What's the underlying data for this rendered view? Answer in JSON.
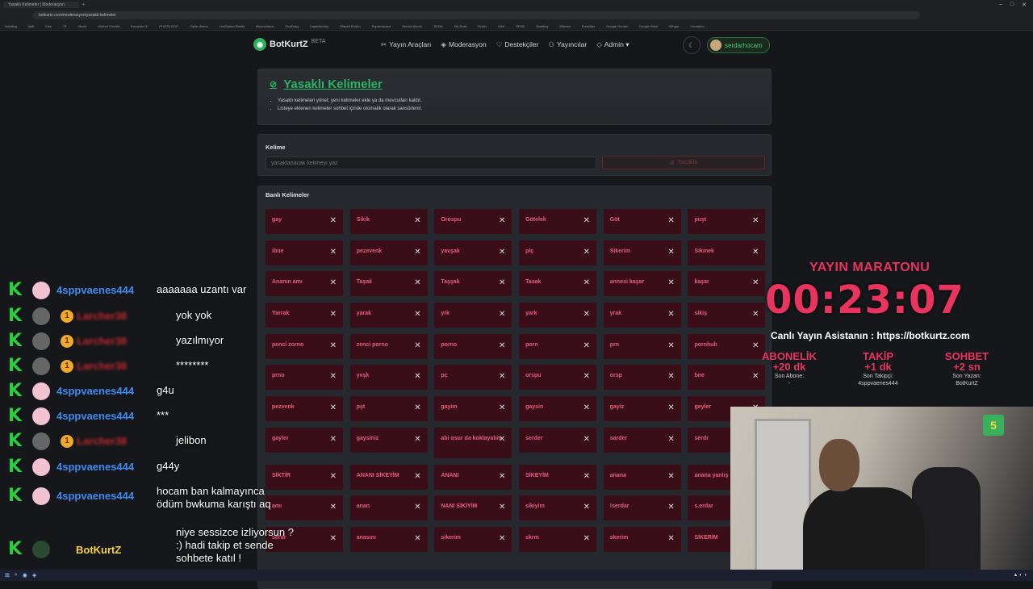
{
  "browser": {
    "tab_title": "Yasaklı Kelimeler | Moderasyon",
    "url": "botkurtz.com/moderasyon/yasakli-kelimeler",
    "bookmarks": [
      "Instaling",
      "İyafi",
      "Kick",
      "YT",
      "Music",
      "Winbef Checkti",
      "Envanter IY",
      "PHOTN EDIT",
      "Cyber Arena",
      "LiveSpeed Rakibi",
      "Meyvedance",
      "OneDrag",
      "Capacitorkey",
      "Olaneti Rodeo",
      "Squarespace",
      "Servlar Album",
      "TikTok",
      "Kik-Chat",
      "Flutter",
      "Kirbi",
      "SEND",
      "Madalay",
      "Mümaa",
      "Freeclips",
      "Google Gemini",
      "Google Slaat",
      "Klingor",
      "Contadoo"
    ]
  },
  "nav": {
    "brand": "BotKurtZ",
    "beta": "BETA",
    "items": [
      {
        "icon": "✂",
        "label": "Yayın Araçları"
      },
      {
        "icon": "◈",
        "label": "Moderasyon"
      },
      {
        "icon": "♡",
        "label": "Destekçiler"
      },
      {
        "icon": "⚇",
        "label": "Yayıncılar"
      },
      {
        "icon": "◇",
        "label": "Admin ▾"
      }
    ],
    "username": "serdarhocam"
  },
  "page": {
    "title": "Yasaklı Kelimeler",
    "desc1": "Yasaklı kelimeleri yönet; yeni kelimeler ekle ya da mevcutları kaldır.",
    "desc2": "Listeye eklenen kelimeler sohbet içinde otomatik olarak sansürlenir."
  },
  "form": {
    "label": "Kelime",
    "placeholder": "yasaklanacak kelimeyi yaz",
    "button": "Yasakla"
  },
  "list": {
    "title": "Banlı Kelimeler",
    "words": [
      "gay",
      "Sikik",
      "Orospu",
      "Götelek",
      "Göt",
      "puşt",
      "ibne",
      "pezevenk",
      "yavşak",
      "piç",
      "Sikerim",
      "Sikmek",
      "Ananın amı",
      "Taşak",
      "Taşşak",
      "Tasak",
      "annesi kaşar",
      "kaşar",
      "Yarrak",
      "yarak",
      "yrk",
      "yark",
      "yrak",
      "sikiş",
      "penci zorno",
      "zenci porno",
      "porno",
      "porn",
      "prn",
      "pornhub",
      "prno",
      "yvşk",
      "pç",
      "orspu",
      "orsp",
      "bne",
      "pezvenk",
      "pşt",
      "gayim",
      "gaysin",
      "gayiz",
      "geyler",
      "gayler",
      "gaysiniz",
      "abi osur da koklayalım",
      "serder",
      "sarder",
      "serdr",
      "SİKTİR",
      "ANANI SİKEYİM",
      "ANANI",
      "SİKEYİM",
      "anana",
      "anana yanlış",
      "amı",
      "anan",
      "NANI SİKİYİM",
      "sikiyim",
      "!serdar",
      "s.erdar",
      "serdr",
      "anasını",
      "sikerim",
      "skrm",
      "skerim",
      "SİKERİM"
    ]
  },
  "overlay": {
    "title": "YAYIN MARATONU",
    "timer": "00:23:07",
    "assistant": "Canlı Yayın Asistanın : https://botkurtz.com",
    "stats": [
      {
        "label": "ABONELİK",
        "value": "+20 dk",
        "sub1": "Son Abone:",
        "sub2": "-"
      },
      {
        "label": "TAKİP",
        "value": "+1 dk",
        "sub1": "Son Takipçi:",
        "sub2": "4sppvaenes444"
      },
      {
        "label": "SOHBET",
        "value": "+2 sn",
        "sub1": "Son Yazan:",
        "sub2": "BotKurtZ"
      }
    ],
    "cam_badge": "5"
  },
  "chat": [
    {
      "user": "4sppvaenes444",
      "kind": "blue",
      "msg": "aaaaaaa uzantı var"
    },
    {
      "user": "Larcher38",
      "kind": "red",
      "msg": "yok yok"
    },
    {
      "user": "Larcher38",
      "kind": "red",
      "msg": "yazılmıyor"
    },
    {
      "user": "Larcher38",
      "kind": "red",
      "msg": "********"
    },
    {
      "user": "4sppvaenes444",
      "kind": "blue",
      "msg": "g4u"
    },
    {
      "user": "4sppvaenes444",
      "kind": "blue",
      "msg": "***"
    },
    {
      "user": "Larcher38",
      "kind": "red",
      "msg": "jelibon"
    },
    {
      "user": "4sppvaenes444",
      "kind": "blue",
      "msg": "g44y"
    },
    {
      "user": "4sppvaenes444",
      "kind": "blue",
      "msg": "hocam ban kalmayınca ödüm bwkuma karıştı aq"
    }
  ],
  "bot": {
    "name": "BotKurtZ",
    "msg": "niye sessizce izliyorsun ? :) hadi takip et sende sohbete katıl !"
  }
}
